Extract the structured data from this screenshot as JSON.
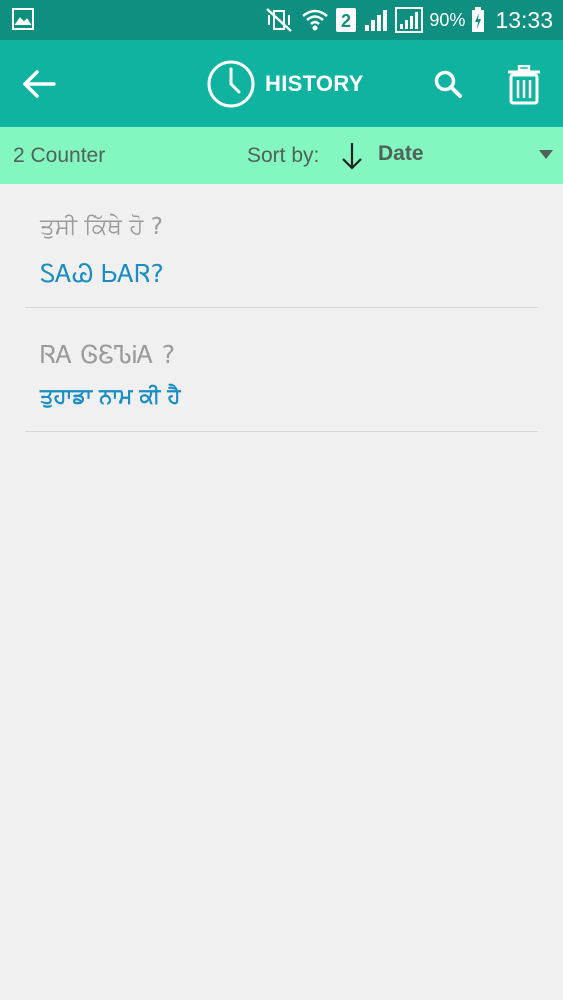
{
  "status_bar": {
    "battery_percent": "90%",
    "time": "13:33",
    "sim_slot": "2",
    "icons": [
      "gallery-notification-icon",
      "vibrate-mute-icon",
      "wifi-icon",
      "sim-2-icon",
      "signal-icon",
      "signal-icon",
      "battery-charging-icon"
    ]
  },
  "app_bar": {
    "title": "HISTORY",
    "back_icon": "arrow-left-icon",
    "title_icon": "clock-icon",
    "search_icon": "search-icon",
    "delete_icon": "trash-icon"
  },
  "sort_bar": {
    "counter": "2 Counter",
    "sort_label": "Sort by:",
    "sort_direction_icon": "arrow-down-icon",
    "sort_value": "Date"
  },
  "history": [
    {
      "source": "ਤੁਸੀ ਕਿੱਥੇ ਹੋ ?",
      "translation": "ᏚᎪᏊ ᏏᎪᏒ?"
    },
    {
      "source": "ᏒᎪ ᎶᏋᏖᎥᎪ ?",
      "translation": "ਤੁਹਾਡਾ ਨਾਮ ਕੀ ਹੈ"
    }
  ],
  "colors": {
    "status_bar": "#0e8f80",
    "app_bar": "#10b3a0",
    "sort_bar": "#84f6c0",
    "translation_text": "#1a8dc4",
    "source_text": "#9a9a9a",
    "background": "#f0f0f0"
  }
}
